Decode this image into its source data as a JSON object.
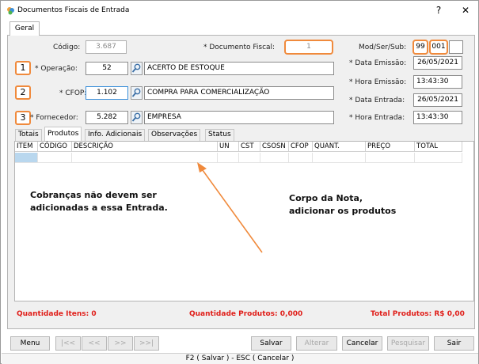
{
  "window": {
    "title": "Documentos Fiscais de Entrada",
    "help": "?",
    "close": "✕"
  },
  "main_tab": "Geral",
  "form": {
    "codigo_label": "Código:",
    "codigo_value": "3.687",
    "documento_label": "* Documento Fiscal:",
    "documento_value": "1",
    "modsersub_label": "Mod/Ser/Sub:",
    "mod_value": "99",
    "ser_value": "001",
    "sub_value": "",
    "operacao_label": "* Operação:",
    "operacao_code": "52",
    "operacao_desc": "ACERTO DE ESTOQUE",
    "cfop_label": "* CFOP:",
    "cfop_code": "1.102",
    "cfop_desc": "COMPRA PARA COMERCIALIZAÇÃO",
    "fornecedor_label": "* Fornecedor:",
    "fornecedor_code": "5.282",
    "fornecedor_desc": "EMPRESA",
    "data_emissao_label": "* Data Emissão:",
    "data_emissao_value": "26/05/2021",
    "hora_emissao_label": "* Hora Emissão:",
    "hora_emissao_value": "13:43:30",
    "data_entrada_label": "* Data Entrada:",
    "data_entrada_value": "26/05/2021",
    "hora_entrada_label": "* Hora Entrada:",
    "hora_entrada_value": "13:43:30"
  },
  "callouts": [
    "1",
    "2",
    "3"
  ],
  "subtabs": [
    "Totais",
    "Produtos",
    "Info. Adicionais",
    "Observações",
    "Status"
  ],
  "grid_columns": [
    "ITEM",
    "CÓDIGO",
    "DESCRIÇÃO",
    "UN",
    "CST",
    "CSOSN",
    "CFOP",
    "QUANT.",
    "PREÇO",
    "TOTAL"
  ],
  "notes": {
    "cobrancas_line1": "Cobranças não devem ser",
    "cobrancas_line2": "adicionadas a essa Entrada.",
    "corpo_line1": "Corpo da Nota,",
    "corpo_line2": "adicionar os produtos"
  },
  "annotation_color": "#f08a3c",
  "alert_color": "#e0201b",
  "footer": {
    "quantidade_itens": "Quantidade Itens: 0",
    "quantidade_produtos": "Quantidade Produtos: 0,000",
    "total_produtos": "Total Produtos: R$ 0,00"
  },
  "buttons": {
    "menu": "Menu",
    "first": "|<<",
    "prev": "<<",
    "next": ">>",
    "last": ">>|",
    "salvar": "Salvar",
    "alterar": "Alterar",
    "cancelar": "Cancelar",
    "pesquisar": "Pesquisar",
    "sair": "Sair"
  },
  "status_bar": "F2 ( Salvar )  -  ESC ( Cancelar )"
}
